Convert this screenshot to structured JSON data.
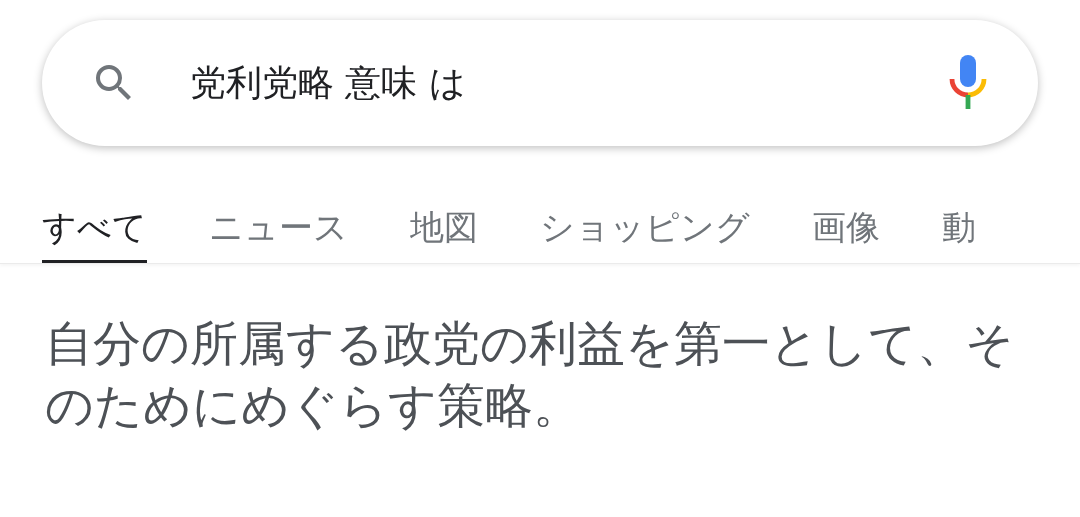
{
  "search": {
    "value": "党利党略 意味 は"
  },
  "tabs": [
    {
      "label": "すべて",
      "selected": true
    },
    {
      "label": "ニュース",
      "selected": false
    },
    {
      "label": "地図",
      "selected": false
    },
    {
      "label": "ショッピング",
      "selected": false
    },
    {
      "label": "画像",
      "selected": false
    },
    {
      "label": "動",
      "selected": false
    }
  ],
  "answer": "自分の所属する政党の利益を第一として、そのためにめぐらす策略。"
}
